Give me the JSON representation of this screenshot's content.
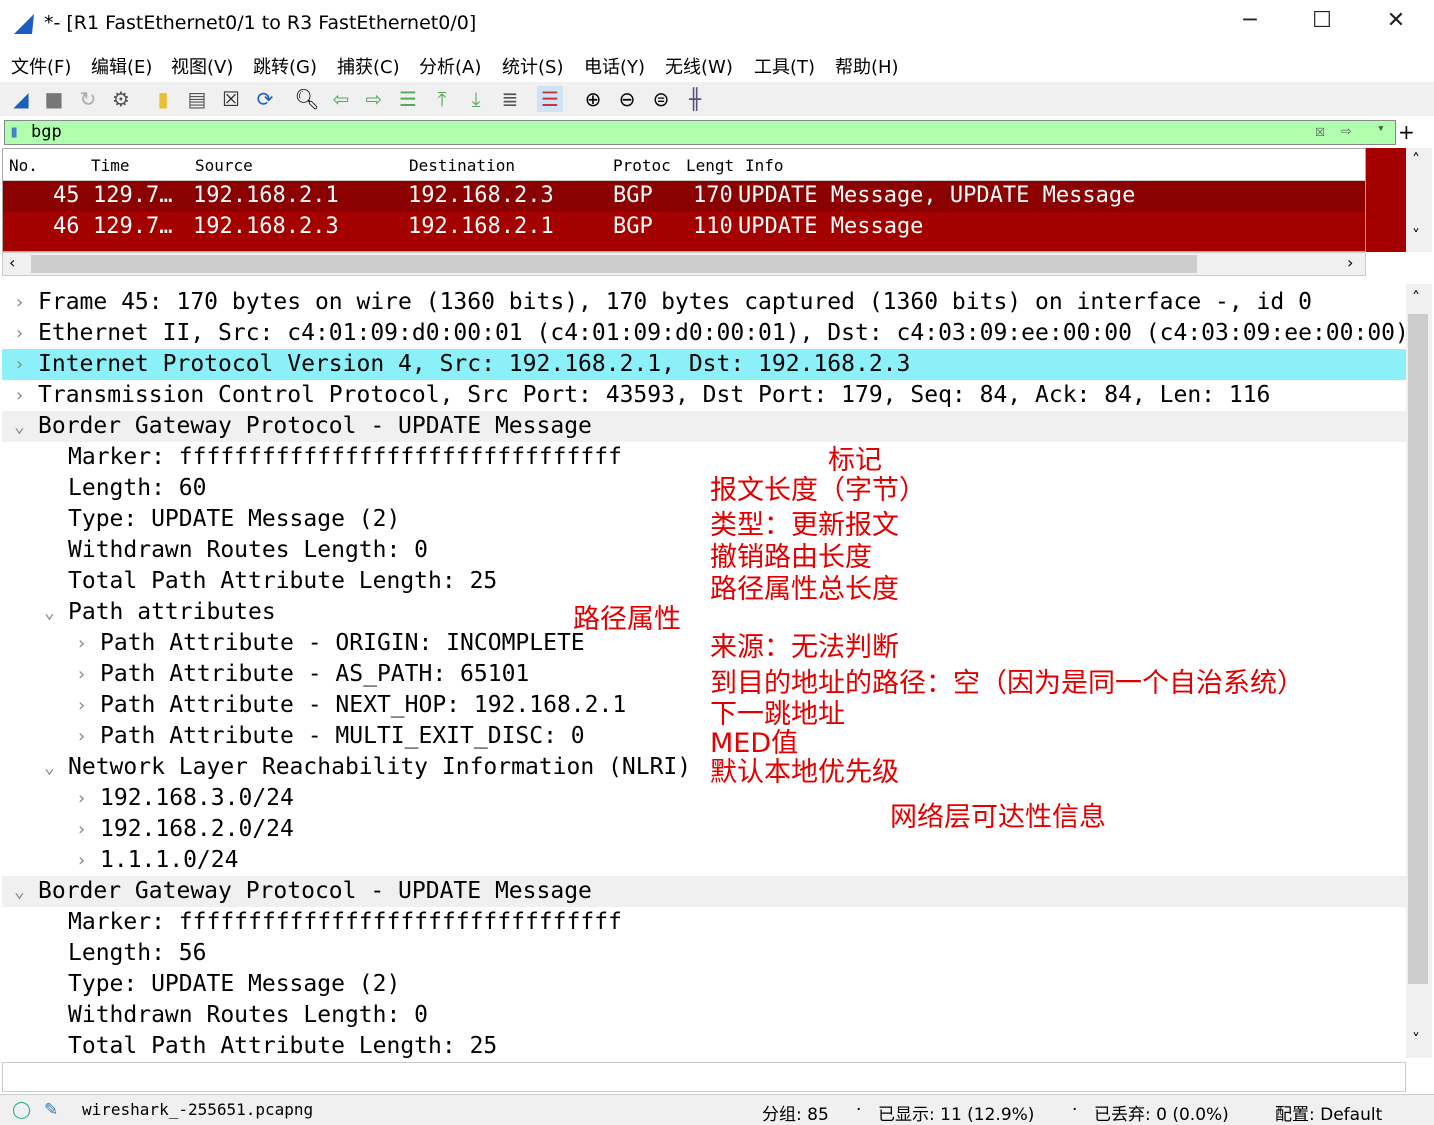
{
  "window": {
    "title": "*- [R1 FastEthernet0/1 to R3 FastEthernet0/0]",
    "minimize": "─",
    "maximize": "☐",
    "close": "✕"
  },
  "menu": [
    "文件(F)",
    "编辑(E)",
    "视图(V)",
    "跳转(G)",
    "捕获(C)",
    "分析(A)",
    "统计(S)",
    "电话(Y)",
    "无线(W)",
    "工具(T)",
    "帮助(H)"
  ],
  "toolbar": [
    "shark-fin-icon",
    "stop-icon",
    "restart-icon",
    "options-icon",
    "open-icon",
    "save-icon",
    "close-file-icon",
    "reload-icon",
    "find-icon",
    "back-icon",
    "forward-icon",
    "goto-icon",
    "first-icon",
    "last-icon",
    "autoscroll-icon",
    "colorize-icon",
    "zoom-in-icon",
    "zoom-out-icon",
    "zoom-reset-icon",
    "resize-columns-icon"
  ],
  "filter": {
    "value": "bgp",
    "add": "+"
  },
  "packet_list": {
    "columns": [
      "No.",
      "Time",
      "Source",
      "Destination",
      "Protoc",
      "Lengt",
      "Info"
    ],
    "rows": [
      {
        "no": "45",
        "time": "129.7…",
        "src": "192.168.2.1",
        "dst": "192.168.2.3",
        "proto": "BGP",
        "len": "170",
        "info": "UPDATE Message, UPDATE Message"
      },
      {
        "no": "46",
        "time": "129.7…",
        "src": "192.168.2.3",
        "dst": "192.168.2.1",
        "proto": "BGP",
        "len": "110",
        "info": "UPDATE Message"
      }
    ]
  },
  "details": [
    {
      "text": "Frame 45: 170 bytes on wire (1360 bits), 170 bytes captured (1360 bits) on interface -, id 0",
      "level": 0,
      "arrow": "›"
    },
    {
      "text": "Ethernet II, Src: c4:01:09:d0:00:01 (c4:01:09:d0:00:01), Dst: c4:03:09:ee:00:00 (c4:03:09:ee:00:00)",
      "level": 0,
      "arrow": "›"
    },
    {
      "text": "Internet Protocol Version 4, Src: 192.168.2.1, Dst: 192.168.2.3",
      "level": 0,
      "arrow": "›",
      "hl": true
    },
    {
      "text": "Transmission Control Protocol, Src Port: 43593, Dst Port: 179, Seq: 84, Ack: 84, Len: 116",
      "level": 0,
      "arrow": "›"
    },
    {
      "text": "Border Gateway Protocol - UPDATE Message",
      "level": 0,
      "arrow": "⌄",
      "grp": true
    },
    {
      "text": "Marker: ffffffffffffffffffffffffffffffff",
      "level": 1,
      "arrow": ""
    },
    {
      "text": "Length: 60",
      "level": 1,
      "arrow": ""
    },
    {
      "text": "Type: UPDATE Message (2)",
      "level": 1,
      "arrow": ""
    },
    {
      "text": "Withdrawn Routes Length: 0",
      "level": 1,
      "arrow": ""
    },
    {
      "text": "Total Path Attribute Length: 25",
      "level": 1,
      "arrow": ""
    },
    {
      "text": "Path attributes",
      "level": 1,
      "arrow": "⌄"
    },
    {
      "text": "Path Attribute - ORIGIN: INCOMPLETE",
      "level": 2,
      "arrow": "›"
    },
    {
      "text": "Path Attribute - AS_PATH: 65101",
      "level": 2,
      "arrow": "›"
    },
    {
      "text": "Path Attribute - NEXT_HOP: 192.168.2.1",
      "level": 2,
      "arrow": "›"
    },
    {
      "text": "Path Attribute - MULTI_EXIT_DISC: 0",
      "level": 2,
      "arrow": "›"
    },
    {
      "text": "Network Layer Reachability Information (NLRI)",
      "level": 1,
      "arrow": "⌄"
    },
    {
      "text": "192.168.3.0/24",
      "level": 2,
      "arrow": "›"
    },
    {
      "text": "192.168.2.0/24",
      "level": 2,
      "arrow": "›"
    },
    {
      "text": "1.1.1.0/24",
      "level": 2,
      "arrow": "›"
    },
    {
      "text": "Border Gateway Protocol - UPDATE Message",
      "level": 0,
      "arrow": "⌄",
      "grp": true
    },
    {
      "text": "Marker: ffffffffffffffffffffffffffffffff",
      "level": 1,
      "arrow": ""
    },
    {
      "text": "Length: 56",
      "level": 1,
      "arrow": ""
    },
    {
      "text": "Type: UPDATE Message (2)",
      "level": 1,
      "arrow": ""
    },
    {
      "text": "Withdrawn Routes Length: 0",
      "level": 1,
      "arrow": ""
    },
    {
      "text": "Total Path Attribute Length: 25",
      "level": 1,
      "arrow": ""
    }
  ],
  "annotations": {
    "marker": "标记",
    "length": "报文长度（字节）",
    "type": "类型：更新报文",
    "withdrawn": "撤销路由长度",
    "total": "路径属性总长度",
    "path_attr": "路径属性",
    "origin": "来源：无法判断",
    "as_path": "到目的地址的路径：空（因为是同一个自治系统）",
    "next_hop": "下一跳地址",
    "med": "MED值",
    "local_pref": "默认本地优先级",
    "nlri": "网络层可达性信息"
  },
  "status": {
    "file": "wireshark_-255651.pcapng",
    "packets": "分组: 85",
    "displayed": "已显示: 11 (12.9%)",
    "dropped": "已丢弃: 0 (0.0%)",
    "profile": "配置: Default"
  },
  "colors": {
    "packet_row": "#a40000",
    "filter_bg": "#afffaf",
    "highlight": "#8cf0f8",
    "annotation": "#e00000"
  }
}
